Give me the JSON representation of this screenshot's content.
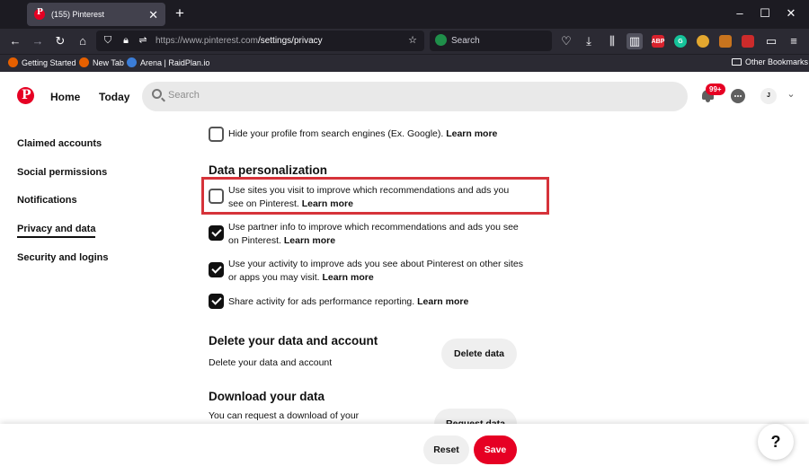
{
  "browser": {
    "tab_title": "(155) Pinterest",
    "tab_close": "✕",
    "new_tab": "+",
    "url_host": "https://www.pinterest.com",
    "url_path": "/settings/privacy",
    "search_placeholder": "Search",
    "bookmarks": [
      "Getting Started",
      "New Tab",
      "Arena | RaidPlan.io"
    ],
    "other_bookmarks": "Other Bookmarks",
    "ext_abp": "ABP",
    "ext_g": "G"
  },
  "header": {
    "nav_home": "Home",
    "nav_today": "Today",
    "search_placeholder": "Search",
    "notifications_badge": "99+",
    "avatar_initial": "J"
  },
  "sidebar": {
    "items": [
      {
        "label": "Claimed accounts"
      },
      {
        "label": "Social permissions"
      },
      {
        "label": "Notifications"
      },
      {
        "label": "Privacy and data"
      },
      {
        "label": "Security and logins"
      }
    ]
  },
  "privacy": {
    "hide_profile": {
      "text": "Hide your profile from search engines (Ex. Google).",
      "link": "Learn more",
      "checked": false
    }
  },
  "data_personalization": {
    "heading": "Data personalization",
    "options": [
      {
        "text": "Use sites you visit to improve which recommendations and ads you see on Pinterest.",
        "link": "Learn more",
        "checked": false
      },
      {
        "text": "Use partner info to improve which recommendations and ads you see on Pinterest.",
        "link": "Learn more",
        "checked": true
      },
      {
        "text": "Use your activity to improve ads you see about Pinterest on other sites or apps you may visit.",
        "link": "Learn more",
        "checked": true
      },
      {
        "text": "Share activity for ads performance reporting.",
        "link": "Learn more",
        "checked": true
      }
    ]
  },
  "delete_data": {
    "heading": "Delete your data and account",
    "description": "Delete your data and account",
    "button": "Delete data"
  },
  "download_data": {
    "heading": "Download your data",
    "description": "You can request a download of your",
    "button": "Request data"
  },
  "footer": {
    "reset": "Reset",
    "save": "Save",
    "help": "?"
  },
  "colors": {
    "brand": "#e60023",
    "highlight": "#d6333a"
  }
}
